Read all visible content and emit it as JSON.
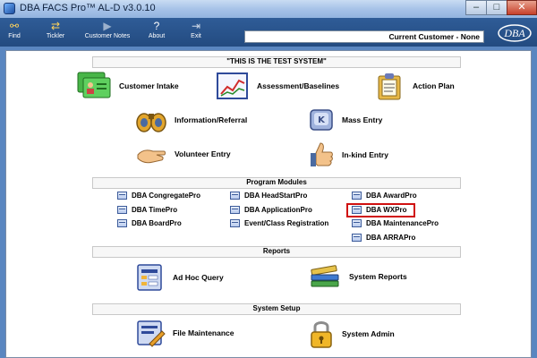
{
  "window": {
    "title": "DBA FACS Pro™ AL-D v3.0.10",
    "controls": [
      "–",
      "□",
      "✕"
    ]
  },
  "toolbar": {
    "buttons": [
      {
        "label": "Find",
        "icon": "binoculars-icon"
      },
      {
        "label": "Tickler",
        "icon": "tickler-icon"
      },
      {
        "label": "Customer Notes",
        "icon": "notes-icon"
      },
      {
        "label": "About",
        "icon": "help-icon"
      },
      {
        "label": "Exit",
        "icon": "exit-icon"
      }
    ],
    "current_customer": "Current Customer - None",
    "logo_text": "DBA"
  },
  "banner": "\"THIS IS THE TEST SYSTEM\"",
  "main_tiles": [
    {
      "label": "Customer Intake",
      "icon": "customer-intake-icon"
    },
    {
      "label": "Assessment/Baselines",
      "icon": "assessment-chart-icon"
    },
    {
      "label": "Action Plan",
      "icon": "clipboard-icon"
    },
    {
      "label": "Information/Referral",
      "icon": "binoculars-icon"
    },
    {
      "label": "Mass Entry",
      "icon": "keyboard-key-icon"
    },
    {
      "label": "Volunteer Entry",
      "icon": "hand-icon"
    },
    {
      "label": "In-kind Entry",
      "icon": "thumbs-up-icon"
    }
  ],
  "program_modules": {
    "title": "Program Modules",
    "items": [
      "DBA CongregatePro",
      "DBA HeadStartPro",
      "DBA AwardPro",
      "DBA TimePro",
      "DBA ApplicationPro",
      "DBA WXPro",
      "DBA BoardPro",
      "Event/Class Registration",
      "DBA MaintenancePro",
      "DBA ARRAPro"
    ],
    "highlighted": "DBA WXPro",
    "highlight_color": "#d01010"
  },
  "reports": {
    "title": "Reports",
    "items": [
      {
        "label": "Ad Hoc Query",
        "icon": "query-icon"
      },
      {
        "label": "System Reports",
        "icon": "books-icon"
      }
    ]
  },
  "system_setup": {
    "title": "System Setup",
    "items": [
      {
        "label": "File Maintenance",
        "icon": "file-maintenance-icon"
      },
      {
        "label": "System Admin",
        "icon": "padlock-icon"
      }
    ]
  },
  "colors": {
    "toolbar": "#2f5c97",
    "titlebar": "#a7c3e8",
    "panel": "#ffffff"
  }
}
